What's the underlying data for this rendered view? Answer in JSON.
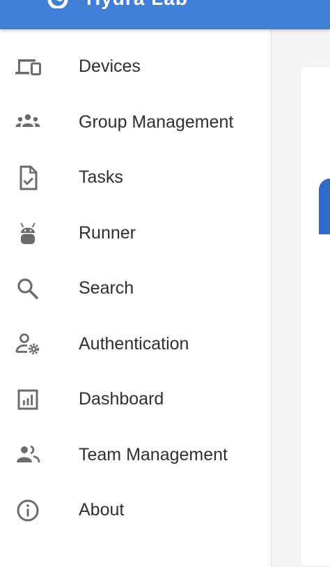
{
  "app": {
    "title": "Hydra Lab",
    "colors": {
      "topbar": "#3f7fd6",
      "icon": "#6b6b6b",
      "text": "#2f2f2f",
      "drawer_background": "#ffffff",
      "content_background": "#f5f5f5"
    }
  },
  "drawer": {
    "items": [
      {
        "label": "Devices",
        "icon": "devices-icon"
      },
      {
        "label": "Group Management",
        "icon": "groups-icon"
      },
      {
        "label": "Tasks",
        "icon": "task-icon"
      },
      {
        "label": "Runner",
        "icon": "android-icon"
      },
      {
        "label": "Search",
        "icon": "search-icon"
      },
      {
        "label": "Authentication",
        "icon": "user-settings-icon"
      },
      {
        "label": "Dashboard",
        "icon": "dashboard-icon"
      },
      {
        "label": "Team Management",
        "icon": "people-icon"
      },
      {
        "label": "About",
        "icon": "info-icon"
      }
    ]
  }
}
